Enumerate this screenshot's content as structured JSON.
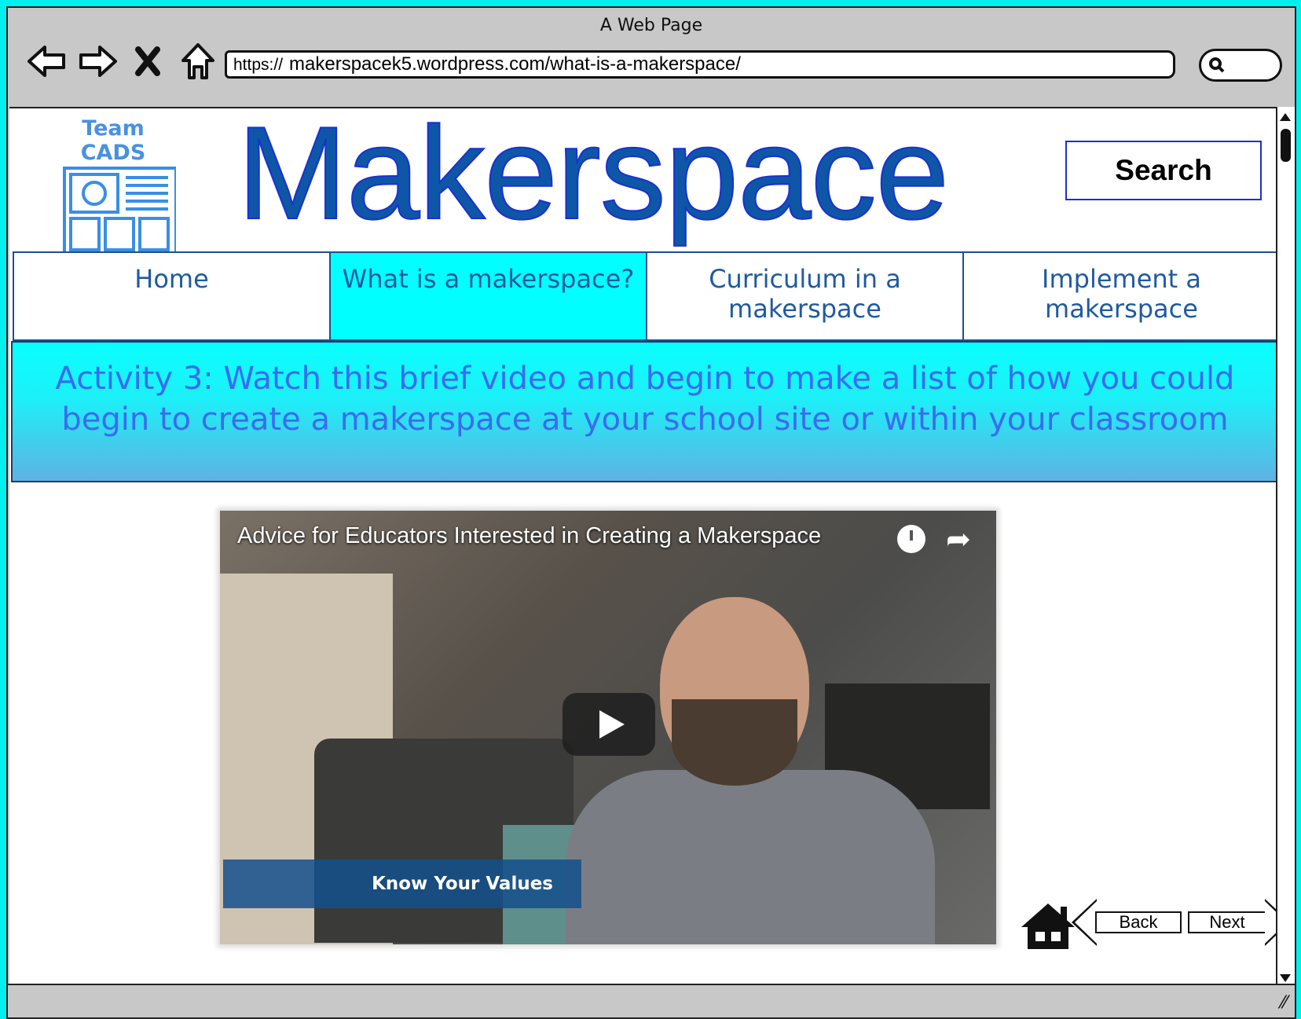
{
  "window": {
    "title": "A Web Page",
    "url_prefix": "https://",
    "url": "makerspacek5.wordpress.com/what-is-a-makerspace/"
  },
  "toolbar": {
    "icons": [
      "back-arrow-icon",
      "forward-arrow-icon",
      "stop-icon",
      "home-icon"
    ]
  },
  "header": {
    "logo_text": "Team CADS",
    "site_title": "Makerspace",
    "search_label": "Search"
  },
  "nav": {
    "tabs": [
      {
        "label": "Home",
        "active": false
      },
      {
        "label": "What is a makerspace?",
        "active": true
      },
      {
        "label": "Curriculum in a makerspace",
        "active": false
      },
      {
        "label": "Implement a makerspace",
        "active": false
      }
    ]
  },
  "activity": {
    "text": "Activity 3: Watch this brief video and begin to make a list of how you could begin to create a makerspace at your school site or within your classroom"
  },
  "video": {
    "title": "Advice for Educators Interested in Creating a Makerspace",
    "caption": "Know Your Values"
  },
  "footer_nav": {
    "back_label": "Back",
    "next_label": "Next"
  },
  "colors": {
    "frame": "#00f0f0",
    "active_tab": "#00ffff",
    "title_blue": "#0d57a6",
    "activity_text": "#3a6cf0"
  }
}
